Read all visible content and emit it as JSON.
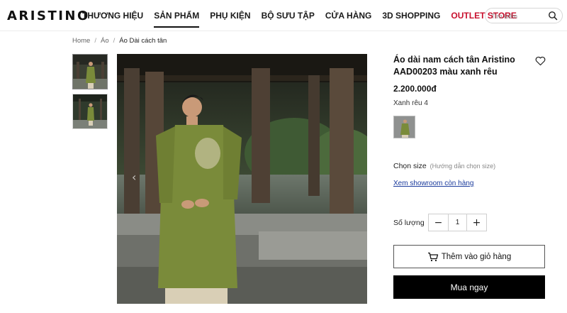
{
  "header": {
    "logo": "ARISTINO",
    "nav": [
      {
        "label": "THƯƠNG HIỆU",
        "active": false
      },
      {
        "label": "SẢN PHẨM",
        "active": true
      },
      {
        "label": "PHỤ KIỆN",
        "active": false
      },
      {
        "label": "BỘ SƯU TẬP",
        "active": false
      },
      {
        "label": "CỬA HÀNG",
        "active": false
      },
      {
        "label": "3D SHOPPING",
        "active": false
      },
      {
        "label": "OUTLET STORE",
        "active": false
      }
    ],
    "search": {
      "placeholder": "Tìm kiếm",
      "value": "",
      "icon": "search-icon"
    }
  },
  "breadcrumb": {
    "home": "Home",
    "category": "Áo",
    "current": "Áo Dài cách tân",
    "separator": "/"
  },
  "product": {
    "title": "Áo dài nam cách tân Aristino AAD00203 màu xanh rêu",
    "price": "2.200.000đ",
    "color_name": "Xanh rêu 4",
    "size_label": "Chọn size",
    "size_guide": "(Hướng dẫn chọn size)",
    "showroom_link": "Xem showroom còn hàng",
    "quantity_label": "Số lượng",
    "quantity": "1",
    "add_to_cart": "Thêm vào giỏ hàng",
    "buy_now": "Mua ngay"
  },
  "icons": {
    "wishlist": "heart-icon",
    "cart": "cart-icon",
    "minus": "−",
    "plus": "+",
    "gallery_prev": "‹"
  },
  "colors": {
    "accent_outlet": "#c8102e",
    "link": "#1a3a9c",
    "buy_button": "#000000",
    "product_green": "#7a8b3a"
  }
}
